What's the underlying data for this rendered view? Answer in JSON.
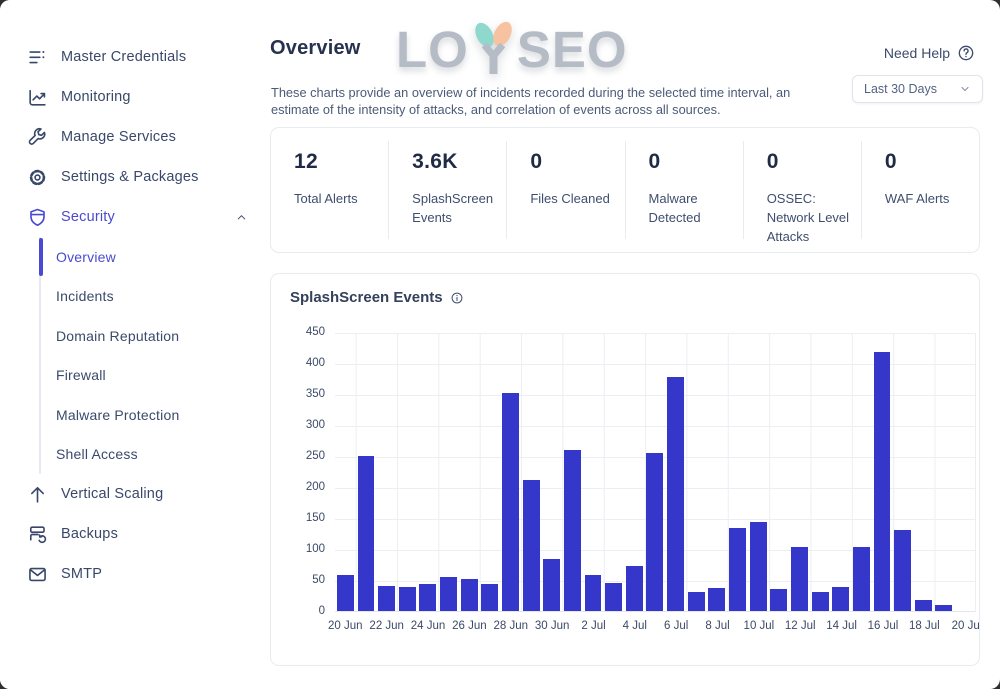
{
  "colors": {
    "accent": "#4a4ad0",
    "bar": "#3437c9",
    "heading": "#26324e",
    "body_text": "#3c4b6b",
    "border": "#e8ebf1",
    "grid": "#eceef2",
    "logo_gray": "#b6bcc5",
    "logo_teal": "#8ed8cd",
    "logo_peach": "#f7c2a0"
  },
  "sidebar": {
    "items": [
      {
        "label": "Master Credentials",
        "icon": "credentials-list-icon"
      },
      {
        "label": "Monitoring",
        "icon": "monitoring-chart-icon"
      },
      {
        "label": "Manage Services",
        "icon": "wrench-icon"
      },
      {
        "label": "Settings & Packages",
        "icon": "gear-icon"
      },
      {
        "label": "Security",
        "icon": "shield-icon",
        "active": true,
        "expanded": true,
        "children": [
          {
            "label": "Overview",
            "active": true
          },
          {
            "label": "Incidents"
          },
          {
            "label": "Domain Reputation"
          },
          {
            "label": "Firewall"
          },
          {
            "label": "Malware Protection"
          },
          {
            "label": "Shell Access"
          }
        ]
      },
      {
        "label": "Vertical Scaling",
        "icon": "arrow-up-icon"
      },
      {
        "label": "Backups",
        "icon": "backups-server-icon"
      },
      {
        "label": "SMTP",
        "icon": "envelope-icon"
      }
    ]
  },
  "header": {
    "title": "Overview",
    "description": "These charts provide an overview of incidents recorded during the selected time interval, an estimate of the intensity of attacks, and correlation of events across all sources.",
    "help_label": "Need Help",
    "time_range_value": "Last 30 Days",
    "logo_left": "LO",
    "logo_right": "SEO"
  },
  "stats": [
    {
      "value": "12",
      "label": "Total Alerts"
    },
    {
      "value": "3.6K",
      "label": "SplashScreen Events"
    },
    {
      "value": "0",
      "label": "Files Cleaned"
    },
    {
      "value": "0",
      "label": "Malware Detected"
    },
    {
      "value": "0",
      "label": "OSSEC: Network Level Attacks"
    },
    {
      "value": "0",
      "label": "WAF Alerts"
    }
  ],
  "chart_data": {
    "type": "bar",
    "title": "SplashScreen Events",
    "categories": [
      "20 Jun",
      "21 Jun",
      "22 Jun",
      "23 Jun",
      "24 Jun",
      "25 Jun",
      "26 Jun",
      "27 Jun",
      "28 Jun",
      "29 Jun",
      "30 Jun",
      "1 Jul",
      "2 Jul",
      "3 Jul",
      "4 Jul",
      "5 Jul",
      "6 Jul",
      "7 Jul",
      "8 Jul",
      "9 Jul",
      "10 Jul",
      "11 Jul",
      "12 Jul",
      "13 Jul",
      "14 Jul",
      "15 Jul",
      "16 Jul",
      "17 Jul",
      "18 Jul",
      "19 Jul",
      "20 Jul"
    ],
    "values": [
      58,
      250,
      41,
      38,
      44,
      55,
      51,
      44,
      351,
      212,
      84,
      260,
      58,
      46,
      73,
      255,
      378,
      31,
      37,
      134,
      143,
      36,
      103,
      31,
      39,
      103,
      418,
      130,
      18,
      9,
      0
    ],
    "x_tick_labels": [
      "20 Jun",
      "22 Jun",
      "24 Jun",
      "26 Jun",
      "28 Jun",
      "30 Jun",
      "2 Jul",
      "4 Jul",
      "6 Jul",
      "8 Jul",
      "10 Jul",
      "12 Jul",
      "14 Jul",
      "16 Jul",
      "18 Jul",
      "20 Ju"
    ],
    "y_ticks": [
      0,
      50,
      100,
      150,
      200,
      250,
      300,
      350,
      400,
      450
    ],
    "ylim": [
      0,
      450
    ],
    "xlabel": "",
    "ylabel": "",
    "grid": true,
    "legend": "none",
    "bar_color": "#3437c9"
  }
}
